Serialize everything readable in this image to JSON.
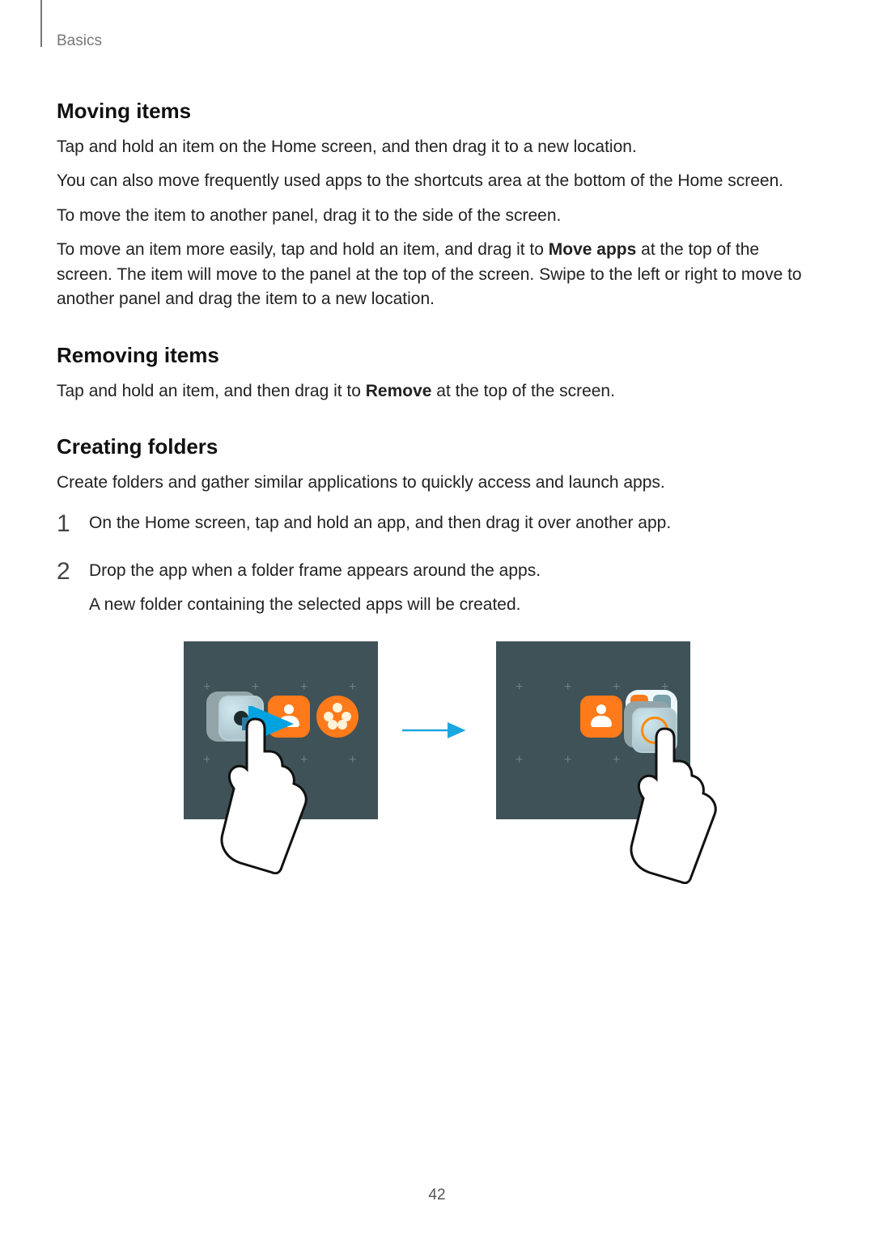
{
  "breadcrumb": "Basics",
  "page_number": "42",
  "sections": {
    "moving": {
      "title": "Moving items",
      "p1": "Tap and hold an item on the Home screen, and then drag it to a new location.",
      "p2": "You can also move frequently used apps to the shortcuts area at the bottom of the Home screen.",
      "p3": "To move the item to another panel, drag it to the side of the screen.",
      "p4_pre": "To move an item more easily, tap and hold an item, and drag it to ",
      "p4_bold": "Move apps",
      "p4_post": " at the top of the screen. The item will move to the panel at the top of the screen. Swipe to the left or right to move to another panel and drag the item to a new location."
    },
    "removing": {
      "title": "Removing items",
      "p1_pre": "Tap and hold an item, and then drag it to ",
      "p1_bold": "Remove",
      "p1_post": " at the top of the screen."
    },
    "folders": {
      "title": "Creating folders",
      "intro": "Create folders and gather similar applications to quickly access and launch apps.",
      "step1": "On the Home screen, tap and hold an app, and then drag it over another app.",
      "step2": "Drop the app when a folder frame appears around the apps.",
      "step2_sub": "A new folder containing the selected apps will be created."
    }
  }
}
